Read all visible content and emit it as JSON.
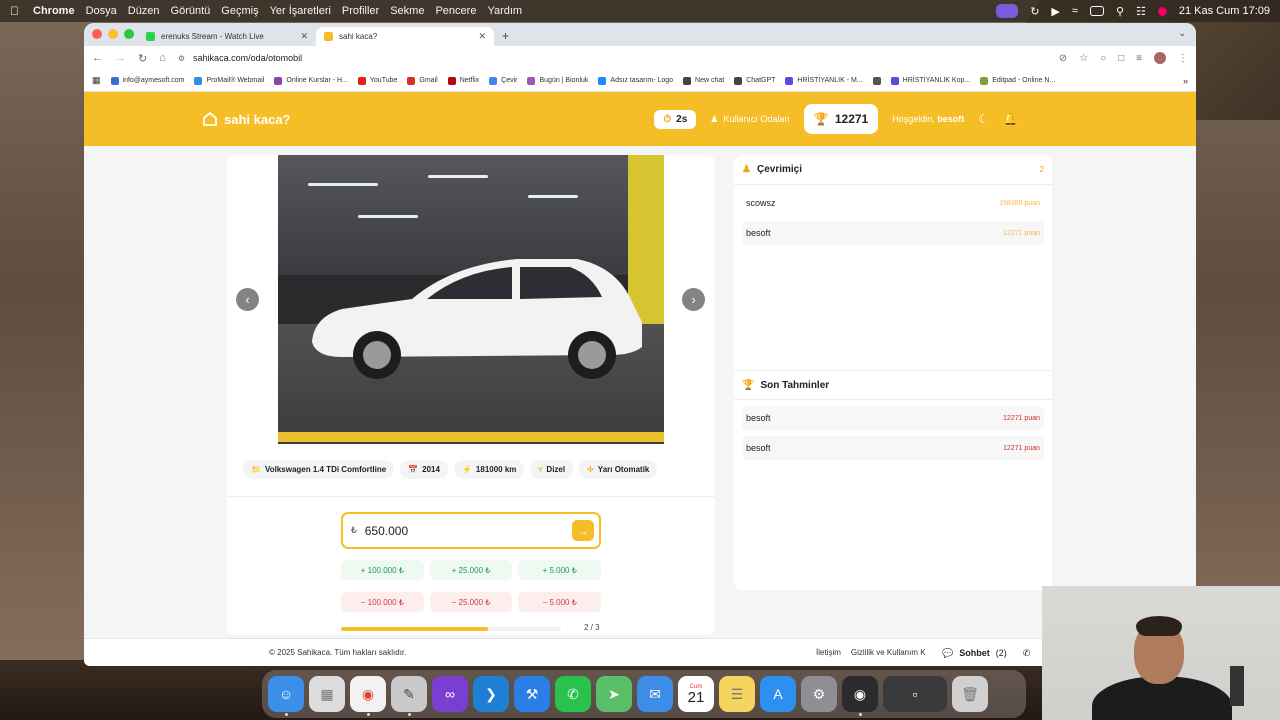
{
  "menubar": {
    "app": "Chrome",
    "items": [
      "Dosya",
      "Düzen",
      "Görüntü",
      "Geçmiş",
      "Yer İşaretleri",
      "Profiller",
      "Sekme",
      "Pencere",
      "Yardım"
    ],
    "datetime": "21 Kas Cum  17:09"
  },
  "tabs": [
    {
      "title": "erenuks Stream - Watch Live",
      "favicon_color": "#2bd34a"
    },
    {
      "title": "sahi kaca?",
      "favicon_color": "#f5bd26"
    }
  ],
  "address": {
    "url": "sahikaca.com/oda/otomobil"
  },
  "bookmarks": [
    {
      "label": "info@aymesoft.com",
      "color": "#3a6bd9"
    },
    {
      "label": "ProMail® Webmail",
      "color": "#2b8fe6"
    },
    {
      "label": "Online Kurslar - H...",
      "color": "#8e44ad"
    },
    {
      "label": "YouTube",
      "color": "#e62117"
    },
    {
      "label": "Gmail",
      "color": "#d93025"
    },
    {
      "label": "Netflix",
      "color": "#b20710"
    },
    {
      "label": "Çevir",
      "color": "#4285f4"
    },
    {
      "label": "Bugün | Bionluk",
      "color": "#9b59b6"
    },
    {
      "label": "Adsız tasarım- Logo",
      "color": "#1f88ff"
    },
    {
      "label": "New chat",
      "color": "#444"
    },
    {
      "label": "ChatGPT",
      "color": "#444"
    },
    {
      "label": "HRİSTİYANLIK - M...",
      "color": "#5b4bd9"
    },
    {
      "label": "",
      "color": "#555"
    },
    {
      "label": "HRİSTİYANLIK Kop...",
      "color": "#5b4bd9"
    },
    {
      "label": "Editpad - Online N...",
      "color": "#7aa23a"
    }
  ],
  "header": {
    "logo": "sahi kaca?",
    "timer": "2s",
    "users_link": "Kullanıcı Odaları",
    "score": "12271",
    "greeting": "Hoşgeldin,",
    "username": "besoft"
  },
  "car": {
    "chips": [
      {
        "label": "Volkswagen 1.4 TDi Comfortline",
        "icon": "folder-icon"
      },
      {
        "label": "2014",
        "icon": "calendar-icon"
      },
      {
        "label": "181000 km",
        "icon": "bolt-icon"
      },
      {
        "label": "Dizel",
        "icon": "filter-icon"
      },
      {
        "label": "Yarı Otomatik",
        "icon": "gear-icon"
      }
    ]
  },
  "guess": {
    "currency": "₺",
    "value": "650.000",
    "plus": [
      "+ 100.000 ₺",
      "+ 25.000 ₺",
      "+ 5.000 ₺"
    ],
    "minus": [
      "− 100.000 ₺",
      "− 25.000 ₺",
      "− 5.000 ₺"
    ],
    "progress_text": "2 / 3",
    "progress_fraction": 0.667
  },
  "online": {
    "title": "Çevrimiçi",
    "count": "2",
    "users": [
      {
        "name": "scowsz",
        "points": "158380 puan"
      },
      {
        "name": "besoft",
        "points": "12271 puan"
      }
    ]
  },
  "recent": {
    "title": "Son Tahminler",
    "items": [
      {
        "name": "besoft",
        "points": "12271 puan"
      },
      {
        "name": "besoft",
        "points": "12271 puan"
      }
    ]
  },
  "footer": {
    "copyright": "© 2025 Sahikaca. Tüm hakları saklıdır.",
    "links": [
      "İletişim",
      "Gizlilik ve Kullanım K"
    ],
    "chat_label": "Sohbet",
    "chat_count": "(2)"
  },
  "dock": [
    {
      "name": "finder-icon",
      "color": "#3b8fe8"
    },
    {
      "name": "launchpad-icon",
      "color": "#dcdcdc"
    },
    {
      "name": "chrome-icon",
      "color": "#f2f2f2"
    },
    {
      "name": "gimp-icon",
      "color": "#c9c9c9"
    },
    {
      "name": "visual-studio-icon",
      "color": "#7a3fd1"
    },
    {
      "name": "vscode-icon",
      "color": "#1f7fd4"
    },
    {
      "name": "xcode-icon",
      "color": "#2a7ee6"
    },
    {
      "name": "whatsapp-icon",
      "color": "#29c24d"
    },
    {
      "name": "maps-icon",
      "color": "#5bbf6a"
    },
    {
      "name": "mail-icon",
      "color": "#3d8de6"
    },
    {
      "name": "calendar-icon",
      "color": "#ffffff"
    },
    {
      "name": "notes-icon",
      "color": "#f5d560"
    },
    {
      "name": "app-store-icon",
      "color": "#2d8ff0"
    },
    {
      "name": "system-settings-icon",
      "color": "#8e8e93"
    },
    {
      "name": "obs-icon",
      "color": "#2b2b2e"
    },
    {
      "name": "screen-thumb-icon",
      "color": "#3a3a3c"
    },
    {
      "name": "trash-icon",
      "color": "#d0d0d0"
    }
  ],
  "dock_calendar": {
    "month": "Cum",
    "day": "21"
  },
  "colors": {
    "accent": "#f5bd26",
    "positive": "#229a55",
    "negative": "#d23a3a"
  }
}
